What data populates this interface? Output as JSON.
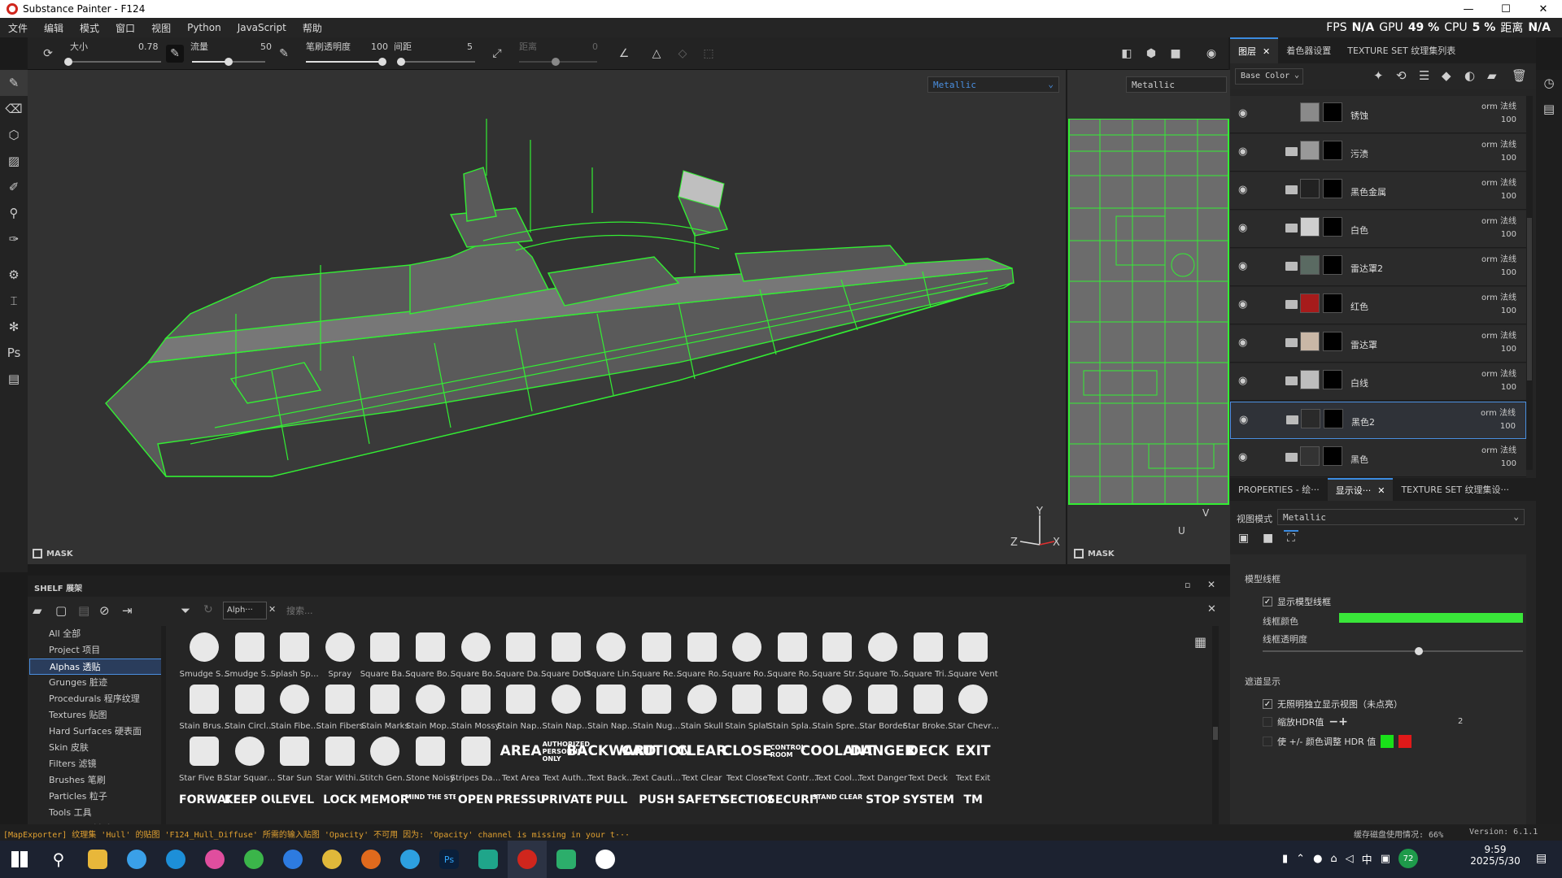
{
  "window": {
    "title": "Substance Painter - F124",
    "min": "—",
    "max": "☐",
    "close": "✕"
  },
  "menu": [
    "文件",
    "编辑",
    "模式",
    "窗口",
    "视图",
    "Python",
    "JavaScript",
    "帮助"
  ],
  "perf": {
    "fps_label": "FPS",
    "fps_value": "N/A",
    "gpu_label": "GPU",
    "gpu_value": "49 %",
    "cpu_label": "CPU",
    "cpu_value": "5 %",
    "time_label": "距离",
    "time_value": "N/A"
  },
  "toolbar": {
    "size_label": "大小",
    "size_value": "0.78",
    "size_fraction": 0.0,
    "flow_label": "流量",
    "flow_value": "50",
    "flow_fraction": 0.5,
    "opacity_label": "笔刷透明度",
    "opacity_value": "100",
    "opacity_fraction": 1.0,
    "spacing_label": "间距",
    "spacing_value": "5",
    "jitter_label": "距离",
    "jitter_value": "0"
  },
  "viewport": {
    "channel": "Metallic",
    "channel2d": "Metallic",
    "mask_label": "MASK",
    "mask_label2": "MASK",
    "axis_y": "Y",
    "axis_z": "Z",
    "axis_x": "X",
    "axis2d_v": "V",
    "axis2d_u": "U",
    "wire_color": "#33ee33"
  },
  "layers_panel": {
    "tabs": [
      {
        "label": "图层",
        "close": "✕"
      },
      {
        "label": "着色器设置"
      },
      {
        "label": "TEXTURE SET 纹理集列表"
      }
    ],
    "channel_select": "Base Color",
    "layers": [
      {
        "name": "锈蚀",
        "blend": "orm 法线",
        "opacity": "100",
        "color": "#8a8a8a",
        "folder": false
      },
      {
        "name": "污渍",
        "blend": "orm 法线",
        "opacity": "100",
        "color": "#999999",
        "folder": true
      },
      {
        "name": "黑色金属",
        "blend": "orm 法线",
        "opacity": "100",
        "color": "#222222",
        "folder": true
      },
      {
        "name": "白色",
        "blend": "orm 法线",
        "opacity": "100",
        "color": "#cfcfcf",
        "folder": true
      },
      {
        "name": "雷达罩2",
        "blend": "orm 法线",
        "opacity": "100",
        "color": "#5a6a62",
        "folder": true
      },
      {
        "name": "红色",
        "blend": "orm 法线",
        "opacity": "100",
        "color": "#a61b1b",
        "folder": true
      },
      {
        "name": "雷达罩",
        "blend": "orm 法线",
        "opacity": "100",
        "color": "#c9b7a6",
        "folder": true
      },
      {
        "name": "白线",
        "blend": "orm 法线",
        "opacity": "100",
        "color": "#bdbdbd",
        "folder": true
      },
      {
        "name": "黑色2",
        "blend": "orm 法线",
        "opacity": "100",
        "color": "#2a2a2a",
        "folder": true
      },
      {
        "name": "黑色",
        "blend": "orm 法线",
        "opacity": "100",
        "color": "#333333",
        "folder": true
      }
    ]
  },
  "properties_panel": {
    "tabs": [
      {
        "label": "PROPERTIES - 绘···"
      },
      {
        "label": "显示设···",
        "close": "✕"
      },
      {
        "label": "TEXTURE SET 纹理集设···"
      }
    ],
    "view_mode_label": "视图模式",
    "view_mode_value": "Metallic",
    "wireframe_section": "模型线框",
    "show_wireframe": "显示模型线框",
    "wireframe_color_label": "线框颜色",
    "wireframe_color": "#39e639",
    "wireframe_opacity_label": "线框透明度",
    "wireframe_opacity_fraction": 0.6,
    "filter_section": "遮道显示",
    "unlit_label": "无照明独立显示视图（未点亮）",
    "hdr_label": "缩放HDR值",
    "hdr_value": "2",
    "hdr_adjust_label": "使 +/- 颜色调整 HDR 值",
    "color_plus": "#19e019",
    "color_minus": "#e01919"
  },
  "shelf": {
    "title": "SHELF 展架",
    "filter_tag": "Alph···",
    "search_placeholder": "搜索...",
    "categories": [
      "All 全部",
      "Project 项目",
      "Alphas 透贴",
      "Grunges 脏迹",
      "Procedurals 程序纹理",
      "Textures 贴图",
      "Hard Surfaces 硬表面",
      "Skin 皮肤",
      "Filters 滤镜",
      "Brushes 笔刷",
      "Particles 粒子",
      "Tools 工具",
      "Materials 材质"
    ],
    "active_category": 2,
    "rows": [
      [
        "Smudge S…",
        "Smudge S…",
        "Splash Sp…",
        "Spray",
        "Square Ba…",
        "Square Bo…",
        "Square Bo…",
        "Square Da…",
        "Square Dots",
        "Square Lin…",
        "Square Re…",
        "Square Ro…",
        "Square Ro…",
        "Square Ro…",
        "Square Str…",
        "Square To…",
        "Square Tri…",
        "Square Vent"
      ],
      [
        "Stain Brus…",
        "Stain Circl…",
        "Stain Fibe…",
        "Stain Fibers",
        "Stain Marks",
        "Stain Mop…",
        "Stain Mossy",
        "Stain Nap…",
        "Stain Nap…",
        "Stain Nap…",
        "Stain Nug…",
        "Stain Skull",
        "Stain Splat",
        "Stain Spla…",
        "Stain Spre…",
        "Star Border",
        "Star Broke…",
        "Star Chevr…"
      ],
      [
        "Star Five B…",
        "Star Squar…",
        "Star Sun",
        "Star Withi…",
        "Stitch Gen…",
        "Stone Noisy",
        "Stripes Da…",
        "Text Area",
        "Text Auth…",
        "Text Back…",
        "Text Cauti…",
        "Text Clear",
        "Text Close",
        "Text Contr…",
        "Text Cool…",
        "Text Danger",
        "Text Deck",
        "Text Exit"
      ],
      [
        "FORWARD",
        "KEEP OUT",
        "LEVEL",
        "LOCK",
        "MEMORY",
        "MIND THE STEP",
        "OPEN",
        "PRESSURE",
        "PRIVATE",
        "PULL",
        "PUSH",
        "SAFETY",
        "SECTION",
        "SECURITY",
        "STAND CLEAR",
        "STOP",
        "SYSTEM",
        "TM"
      ]
    ],
    "text_tiles": [
      "AREA",
      "AUTHORIZED PERSONNEL ONLY",
      "BACKWARD",
      "CAUTION",
      "CLEAR",
      "CLOSE",
      "CONTROL ROOM",
      "COOLANT",
      "DANGER",
      "DECK",
      "EXIT"
    ]
  },
  "status": {
    "log": "[MapExporter] 纹理集 'Hull' 的贴图 'F124_Hull_Diffuse' 所需的输入贴图 'Opacity' 不可用 因为: 'Opacity' channel is missing in your t···",
    "cache": "缓存磁盘使用情况: 66%",
    "version": "Version: 6.1.1"
  },
  "taskbar": {
    "time": "9:59",
    "date": "2025/5/30",
    "weather": "72",
    "lang": "中"
  }
}
